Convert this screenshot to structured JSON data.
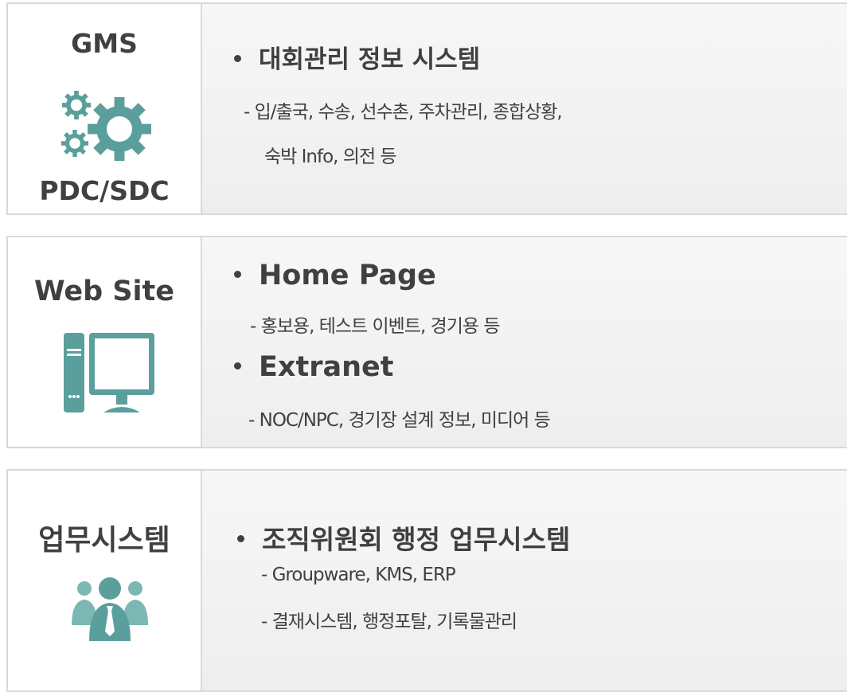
{
  "panels": [
    {
      "left_labels": [
        "GMS",
        "PDC/SDC"
      ],
      "icon": "gears-icon",
      "heading": "대회관리 정보 시스템",
      "details": [
        "- 입/출국, 수송, 선수촌, 주차관리, 종합상황,",
        "숙박 Info, 의전 등"
      ]
    },
    {
      "left_labels": [
        "Web Site"
      ],
      "icon": "computer-icon",
      "heading": "Home Page",
      "details": [
        "- 홍보용, 테스트 이벤트, 경기용 등"
      ],
      "heading2": "Extranet",
      "details2": [
        "- NOC/NPC, 경기장 설계 정보, 미디어 등"
      ]
    },
    {
      "left_labels": [
        "업무시스템"
      ],
      "icon": "people-icon",
      "heading": "조직위원회 행정 업무시스템",
      "details": [
        "- Groupware, KMS, ERP",
        "- 결재시스템, 행정포탈, 기록물관리"
      ]
    }
  ],
  "colors": {
    "icon_teal": "#5a9f9b",
    "icon_teal_light": "#7bb8b4",
    "border": "#d9d9d9",
    "text": "#404040"
  }
}
